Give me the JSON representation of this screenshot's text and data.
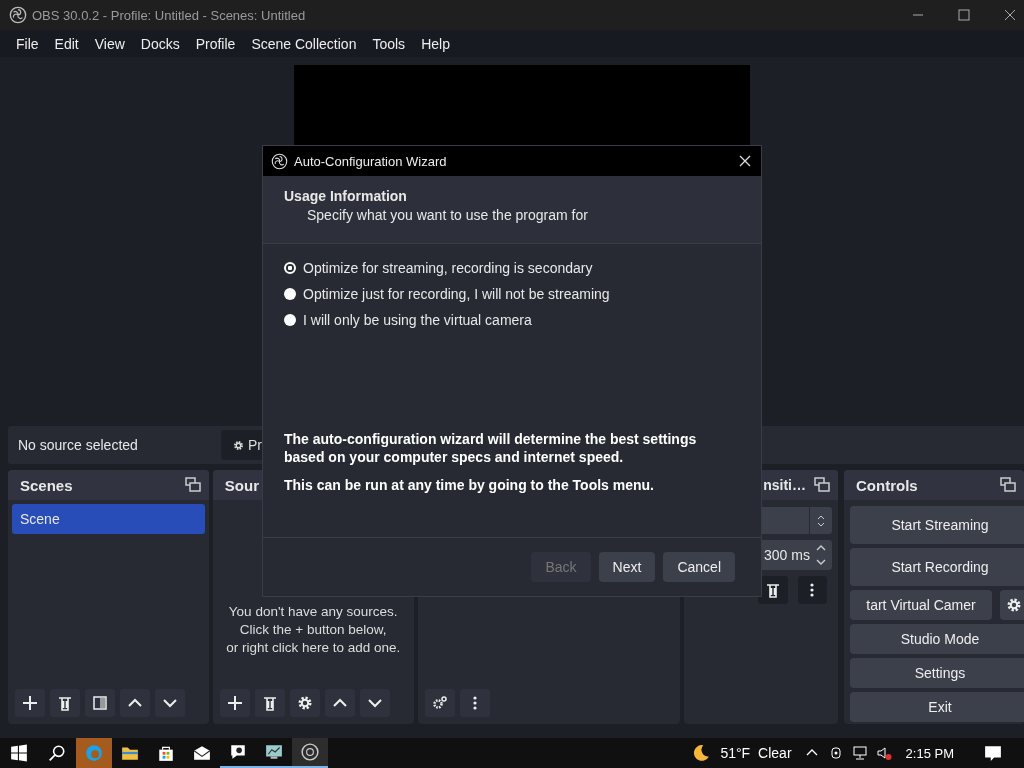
{
  "window": {
    "title": "OBS 30.0.2 - Profile: Untitled - Scenes: Untitled"
  },
  "menu": [
    "File",
    "Edit",
    "View",
    "Docks",
    "Profile",
    "Scene Collection",
    "Tools",
    "Help"
  ],
  "source_toolbar": {
    "status": "No source selected",
    "properties_button": "Pr"
  },
  "scenes": {
    "title": "Scenes",
    "items": [
      {
        "label": "Scene",
        "selected": true
      }
    ]
  },
  "sources": {
    "title": "Sour",
    "empty_text": "You don't have any sources.\nClick the + button below,\nor right click here to add one."
  },
  "transitions": {
    "title": "nsiti…",
    "duration": "300 ms"
  },
  "controls": {
    "title": "Controls",
    "buttons": [
      {
        "label": "Start Streaming",
        "kind": "plain"
      },
      {
        "label": "Start Recording",
        "kind": "plain"
      },
      {
        "label": "tart Virtual Camer",
        "kind": "with-settings"
      },
      {
        "label": "Studio Mode",
        "kind": "plain"
      },
      {
        "label": "Settings",
        "kind": "plain"
      },
      {
        "label": "Exit",
        "kind": "plain"
      }
    ]
  },
  "dialog": {
    "title": "Auto-Configuration Wizard",
    "heading": "Usage Information",
    "subheading": "Specify what you want to use the program for",
    "options": [
      {
        "label": "Optimize for streaming, recording is secondary",
        "selected": true
      },
      {
        "label": "Optimize just for recording, I will not be streaming",
        "selected": false
      },
      {
        "label": "I will only be using the virtual camera",
        "selected": false
      }
    ],
    "notes": [
      "The auto-configuration wizard will determine the best settings based on your computer specs and internet speed.",
      "This can be run at any time by going to the Tools menu."
    ],
    "buttons": [
      {
        "label": "Back",
        "disabled": true
      },
      {
        "label": "Next",
        "disabled": false
      },
      {
        "label": "Cancel",
        "disabled": false
      }
    ]
  },
  "taskbar": {
    "temperature": "51°F",
    "weather": "Clear",
    "time": "2:15 PM"
  }
}
